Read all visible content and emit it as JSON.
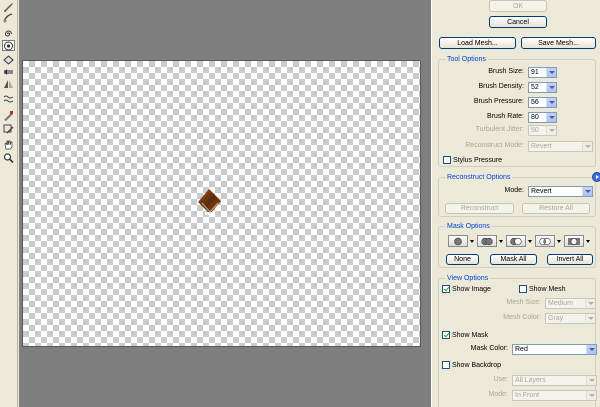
{
  "toolbar": {
    "tools": [
      {
        "icon": "forward-warp-icon",
        "active": false
      },
      {
        "icon": "reconstruct-icon",
        "active": false
      },
      {
        "icon": "twirl-clockwise-icon",
        "active": false
      },
      {
        "icon": "pucker-icon",
        "active": true
      },
      {
        "icon": "bloat-icon",
        "active": false
      },
      {
        "icon": "push-left-icon",
        "active": false
      },
      {
        "icon": "mirror-icon",
        "active": false
      },
      {
        "icon": "turbulence-icon",
        "active": false
      },
      {
        "icon": "freeze-mask-icon",
        "active": false
      },
      {
        "icon": "thaw-mask-icon",
        "active": false
      },
      {
        "icon": "hand-icon",
        "active": false
      },
      {
        "icon": "zoom-icon",
        "active": false
      }
    ]
  },
  "buttons": {
    "ok": "OK",
    "cancel": "Cancel",
    "load_mesh": "Load Mesh...",
    "save_mesh": "Save Mesh..."
  },
  "tool_options": {
    "title": "Tool Options",
    "brush_size_label": "Brush Size:",
    "brush_size_value": "91",
    "brush_density_label": "Brush Density:",
    "brush_density_value": "52",
    "brush_pressure_label": "Brush Pressure:",
    "brush_pressure_value": "56",
    "brush_rate_label": "Brush Rate:",
    "brush_rate_value": "80",
    "turbulent_jitter_label": "Turbulent Jitter:",
    "turbulent_jitter_value": "50",
    "reconstruct_mode_label": "Reconstruct Mode:",
    "reconstruct_mode_value": "Revert",
    "stylus_pressure_label": "Stylus Pressure"
  },
  "reconstruct_options": {
    "title": "Reconstruct Options",
    "mode_label": "Mode:",
    "mode_value": "Revert",
    "reconstruct_button": "Reconstruct",
    "restore_all_button": "Restore All"
  },
  "mask_options": {
    "title": "Mask Options",
    "none_button": "None",
    "mask_all_button": "Mask All",
    "invert_all_button": "Invert All"
  },
  "view_options": {
    "title": "View Options",
    "show_image_label": "Show Image",
    "show_mesh_label": "Show Mesh",
    "mesh_size_label": "Mesh Size:",
    "mesh_size_value": "Medium",
    "mesh_color_label": "Mesh Color:",
    "mesh_color_value": "Gray",
    "show_mask_label": "Show Mask",
    "mask_color_label": "Mask Color:",
    "mask_color_value": "Red",
    "show_backdrop_label": "Show Backdrop",
    "use_label": "Use:",
    "use_value": "All Layers",
    "mode_label": "Mode:",
    "mode_value": "In Front"
  },
  "colors": {
    "panel_bg": "#ece9d8",
    "group_title": "#0046d5",
    "workspace_bg": "#7f7f7f",
    "swatch": "#7a3f16"
  }
}
